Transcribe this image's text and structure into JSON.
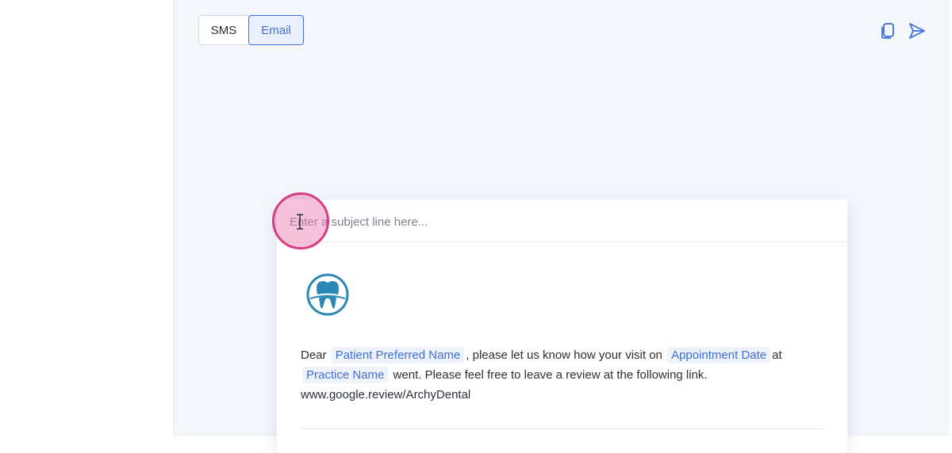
{
  "mode_toggle": {
    "sms_label": "SMS",
    "email_label": "Email",
    "selected": "Email"
  },
  "toolbar": {
    "copy_icon": "copy-icon",
    "send_icon": "send-icon"
  },
  "email": {
    "subject_placeholder": "Enter a subject line here...",
    "subject_value": "",
    "logo_icon": "tooth-logo-icon",
    "body": {
      "dear": "Dear",
      "var_patient_name": "Patient Preferred Name",
      "text_1": ", please let us know how your visit on",
      "var_appointment_date": "Appointment Date",
      "text_2": "at",
      "var_practice_name": "Practice Name",
      "text_3": "went. Please feel free to leave a review at the following link.",
      "link": "www.google.review/ArchyDental"
    }
  },
  "colors": {
    "accent": "#3f6fd8",
    "background": "#f3f6fb",
    "variable_bg": "#eef2fb",
    "logo_blue": "#2b87b6",
    "cursor_highlight": "#d63d86"
  }
}
